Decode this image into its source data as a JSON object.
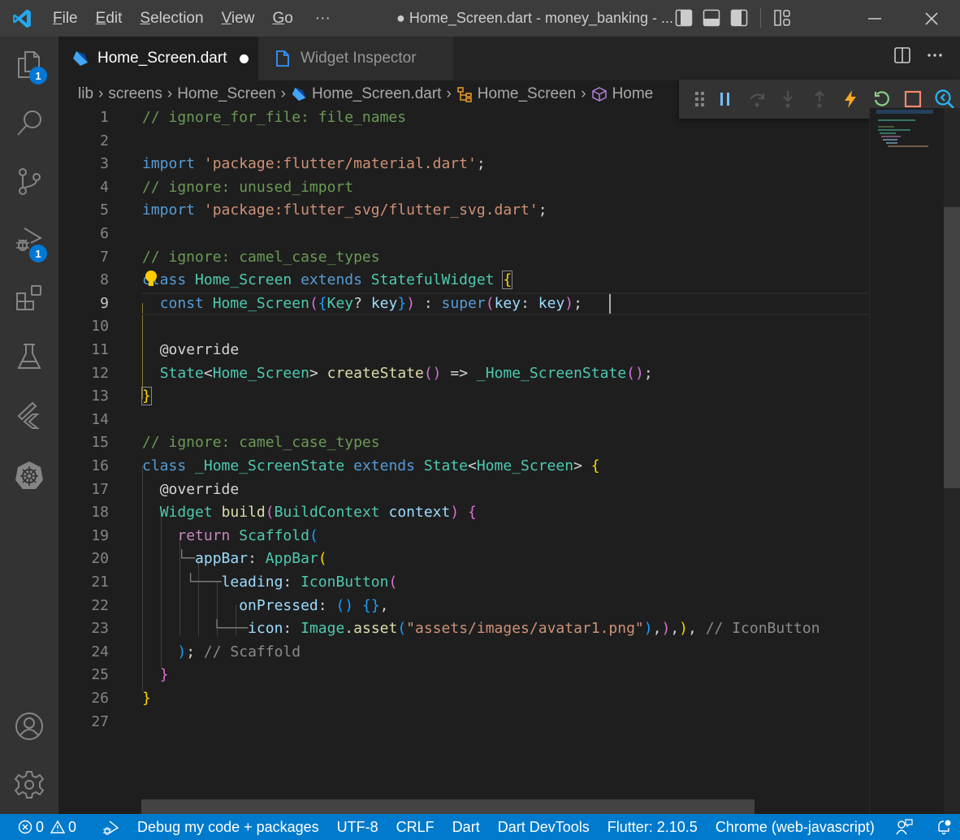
{
  "titlebar": {
    "menu": [
      {
        "label": "File",
        "mnemonic": "F",
        "rest": "ile"
      },
      {
        "label": "Edit",
        "mnemonic": "E",
        "rest": "dit"
      },
      {
        "label": "Selection",
        "mnemonic": "S",
        "rest": "election"
      },
      {
        "label": "View",
        "mnemonic": "V",
        "rest": "iew"
      },
      {
        "label": "Go",
        "mnemonic": "G",
        "rest": "o"
      }
    ],
    "more_label": "···",
    "window_title": "● Home_Screen.dart - money_banking - ...",
    "icons": [
      "toggle-primary-sidebar-icon",
      "toggle-panel-icon",
      "toggle-secondary-sidebar-icon",
      "customize-layout-icon"
    ],
    "controls": [
      "minimize-icon",
      "maximize-icon",
      "close-icon"
    ]
  },
  "activitybar": {
    "items": [
      {
        "name": "explorer",
        "badge": "1"
      },
      {
        "name": "search",
        "badge": null
      },
      {
        "name": "source-control",
        "badge": null
      },
      {
        "name": "run-and-debug",
        "badge": "1"
      },
      {
        "name": "extensions",
        "badge": null
      },
      {
        "name": "testing",
        "badge": null
      },
      {
        "name": "flutter",
        "badge": null
      },
      {
        "name": "kubernetes",
        "badge": null
      }
    ],
    "bottom": [
      "accounts",
      "manage"
    ]
  },
  "tabs": [
    {
      "label": "Home_Screen.dart",
      "dirty": true,
      "active": true,
      "icon": "dart-file-icon"
    },
    {
      "label": "Widget Inspector",
      "dirty": false,
      "active": false,
      "icon": "file-icon"
    }
  ],
  "breadcrumb": [
    "lib",
    "screens",
    "Home_Screen",
    "Home_Screen.dart",
    "Home_Screen",
    "Home"
  ],
  "debug_toolbar": [
    "drag-handle",
    "pause",
    "step-over",
    "step-into",
    "step-out",
    "hot-reload",
    "hot-restart",
    "stop",
    "open-widget-inspector"
  ],
  "editor": {
    "current_line": 9,
    "lines": [
      {
        "n": "1"
      },
      {
        "n": "2"
      },
      {
        "n": "3"
      },
      {
        "n": "4"
      },
      {
        "n": "5"
      },
      {
        "n": "6"
      },
      {
        "n": "7"
      },
      {
        "n": "8"
      },
      {
        "n": "9"
      },
      {
        "n": "10"
      },
      {
        "n": "11"
      },
      {
        "n": "12"
      },
      {
        "n": "13"
      },
      {
        "n": "14"
      },
      {
        "n": "15"
      },
      {
        "n": "16"
      },
      {
        "n": "17"
      },
      {
        "n": "18"
      },
      {
        "n": "19"
      },
      {
        "n": "20"
      },
      {
        "n": "21"
      },
      {
        "n": "22"
      },
      {
        "n": "23"
      },
      {
        "n": "24"
      },
      {
        "n": "25"
      },
      {
        "n": "26"
      },
      {
        "n": "27"
      }
    ],
    "tokens": {
      "l1": "// ignore_for_file: file_names",
      "l3_kw": "import",
      "l3_str": "'package:flutter/material.dart'",
      "l4": "// ignore: unused_import",
      "l5_kw": "import",
      "l5_str": "'package:flutter_svg/flutter_svg.dart'",
      "l7": "// ignore: camel_case_types",
      "l8_kw": "class",
      "l8_name": "Home_Screen",
      "l8_ext": "extends",
      "l8_base": "StatefulWidget",
      "l9_const": "const",
      "l9_name": "Home_Screen",
      "l9_key_t": "Key",
      "l9_key": "key",
      "l9_super": "super",
      "l9_arg": "key",
      "l9_val": "key",
      "l11": "@override",
      "l12_state": "State",
      "l12_gen": "Home_Screen",
      "l12_fn": "createState",
      "l12_ret": "_Home_ScreenState",
      "l15": "// ignore: camel_case_types",
      "l16_kw": "class",
      "l16_name": "_Home_ScreenState",
      "l16_ext": "extends",
      "l16_base": "State",
      "l16_gen": "Home_Screen",
      "l17": "@override",
      "l18_type": "Widget",
      "l18_fn": "build",
      "l18_ptype": "BuildContext",
      "l18_param": "context",
      "l19_ret": "return",
      "l19_cls": "Scaffold",
      "l20_guide": "└─",
      "l20_prop": "appBar",
      "l20_cls": "AppBar",
      "l21_guide": "└───",
      "l21_prop": "leading",
      "l21_cls": "IconButton",
      "l22_prop": "onPressed",
      "l23_guide": "└───",
      "l23_prop": "icon",
      "l23_cls": "Image",
      "l23_fn": "asset",
      "l23_str": "\"assets/images/avatar1.png\"",
      "l23_hint": "// IconButton",
      "l24_hint": "// Scaffold"
    }
  },
  "statusbar": {
    "errors": "0",
    "warnings": "0",
    "debug_mode": "Debug my code + packages",
    "encoding": "UTF-8",
    "eol": "CRLF",
    "language": "Dart",
    "devtools": "Dart DevTools",
    "flutter": "Flutter: 2.10.5",
    "device": "Chrome (web-javascript)"
  },
  "colors": {
    "accent": "#007acc",
    "badge": "#0078d4",
    "titlebar": "#3c3c3c",
    "activitybar": "#333333",
    "editor_bg": "#1e1e1e"
  }
}
